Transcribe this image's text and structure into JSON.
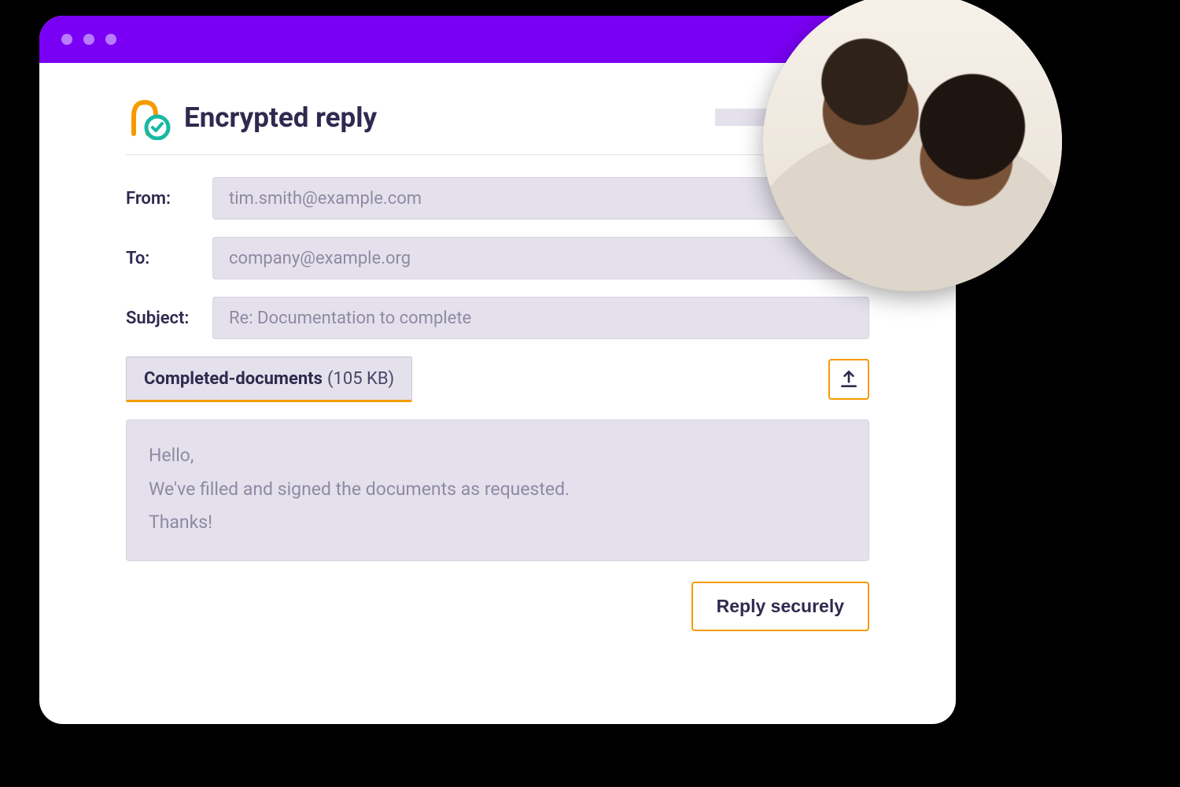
{
  "header": {
    "title": "Encrypted reply"
  },
  "form": {
    "from_label": "From:",
    "from_value": "tim.smith@example.com",
    "to_label": "To:",
    "to_value": "company@example.org",
    "subject_label": "Subject:",
    "subject_value": "Re: Documentation to complete"
  },
  "attachment": {
    "name": "Completed-documents",
    "size": "(105 KB)"
  },
  "message": {
    "line1": "Hello,",
    "line2": "We've filled and signed the documents as requested.",
    "line3": "Thanks!"
  },
  "actions": {
    "reply_label": "Reply securely"
  }
}
